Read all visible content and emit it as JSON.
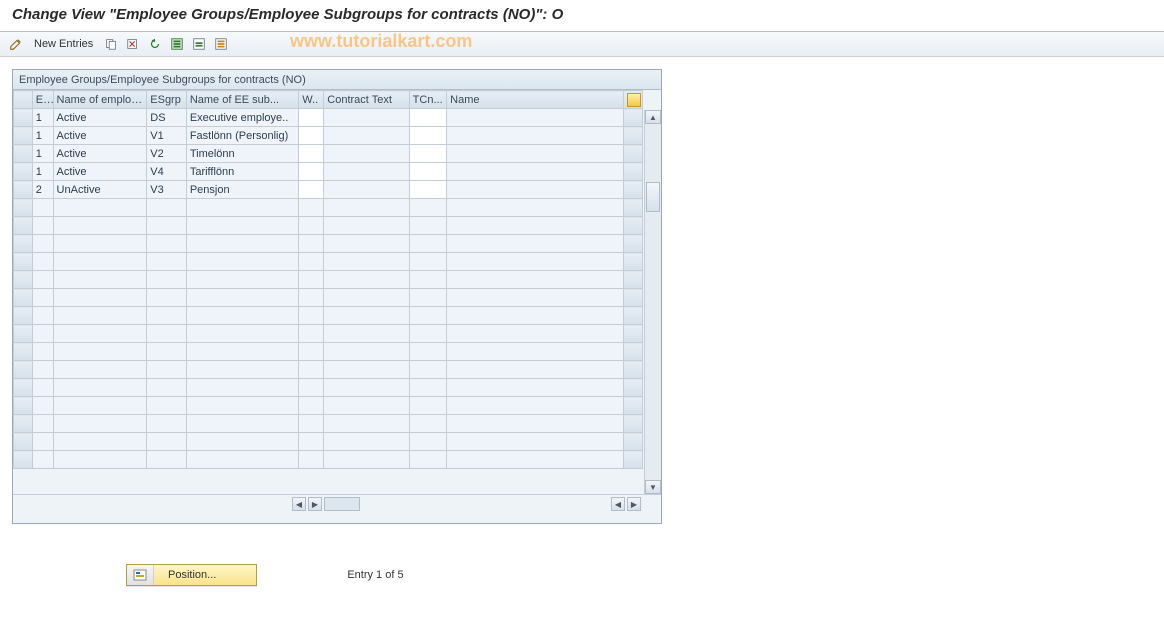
{
  "title": "Change View \"Employee Groups/Employee Subgroups for contracts (NO)\": O",
  "watermark": "www.tutorialkart.com",
  "toolbar": {
    "new_entries_label": "New Entries"
  },
  "panel": {
    "title": "Employee Groups/Employee Subgroups for contracts (NO)"
  },
  "columns": {
    "sel": "",
    "e": "E...",
    "name1": "Name of employ...",
    "esgrp": "ESgrp",
    "name2": "Name of EE sub...",
    "w": "W..",
    "ct": "Contract Text",
    "tcn": "TCn...",
    "name3": "Name"
  },
  "rows": [
    {
      "e": "1",
      "name1": "Active",
      "esgrp": "DS",
      "name2": "Executive employe..",
      "w": "",
      "ct": "",
      "tcn": "",
      "name3": ""
    },
    {
      "e": "1",
      "name1": "Active",
      "esgrp": "V1",
      "name2": "Fastlönn (Personlig)",
      "w": "",
      "ct": "",
      "tcn": "",
      "name3": ""
    },
    {
      "e": "1",
      "name1": "Active",
      "esgrp": "V2",
      "name2": "Timelönn",
      "w": "",
      "ct": "",
      "tcn": "",
      "name3": ""
    },
    {
      "e": "1",
      "name1": "Active",
      "esgrp": "V4",
      "name2": "Tarifflönn",
      "w": "",
      "ct": "",
      "tcn": "",
      "name3": ""
    },
    {
      "e": "2",
      "name1": "UnActive",
      "esgrp": "V3",
      "name2": "Pensjon",
      "w": "",
      "ct": "",
      "tcn": "",
      "name3": ""
    }
  ],
  "empty_row_count": 15,
  "footer": {
    "position_label": "Position...",
    "entry_text": "Entry 1 of 5"
  }
}
